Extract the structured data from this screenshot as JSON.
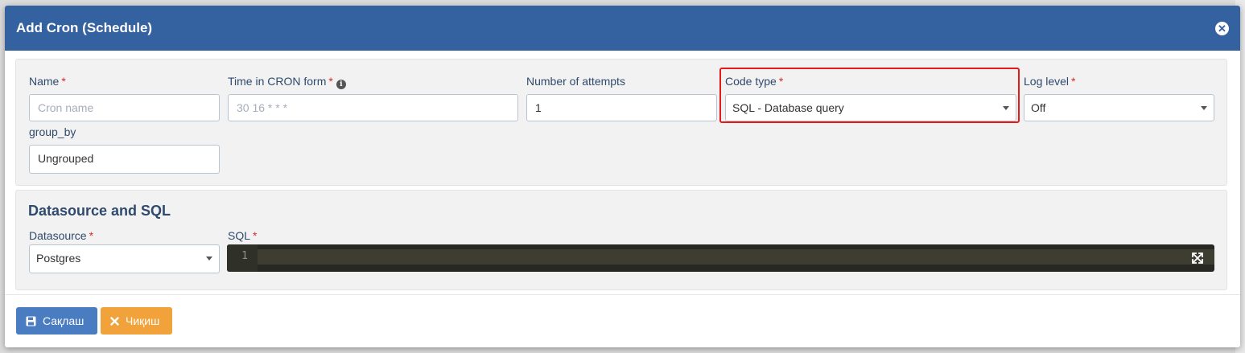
{
  "modal": {
    "title": "Add Cron (Schedule)"
  },
  "fields": {
    "name": {
      "label": "Name",
      "required": "*",
      "placeholder": "Cron name"
    },
    "time": {
      "label": "Time in CRON form",
      "required": "*",
      "placeholder": "30 16 * * *"
    },
    "attempts": {
      "label": "Number of attempts",
      "value": "1"
    },
    "code_type": {
      "label": "Code type",
      "required": "*",
      "value": "SQL - Database query"
    },
    "log_level": {
      "label": "Log level",
      "required": "*",
      "value": "Off"
    },
    "group_by": {
      "label": "group_by",
      "value": "Ungrouped"
    }
  },
  "datasource_section": {
    "title": "Datasource and SQL",
    "datasource": {
      "label": "Datasource",
      "required": "*",
      "value": "Postgres"
    },
    "sql": {
      "label": "SQL",
      "required": "*",
      "line_number": "1"
    }
  },
  "footer": {
    "save_label": "Сақлаш",
    "exit_label": "Чиқиш"
  },
  "icons": {
    "close": "close-icon",
    "info": "info-icon",
    "save": "floppy-icon",
    "exit": "x-icon",
    "expand": "expand-icon"
  },
  "colors": {
    "header": "#3461a0",
    "save_button": "#4a7cc2",
    "exit_button": "#f2a23a",
    "highlight": "#e31b1b"
  }
}
